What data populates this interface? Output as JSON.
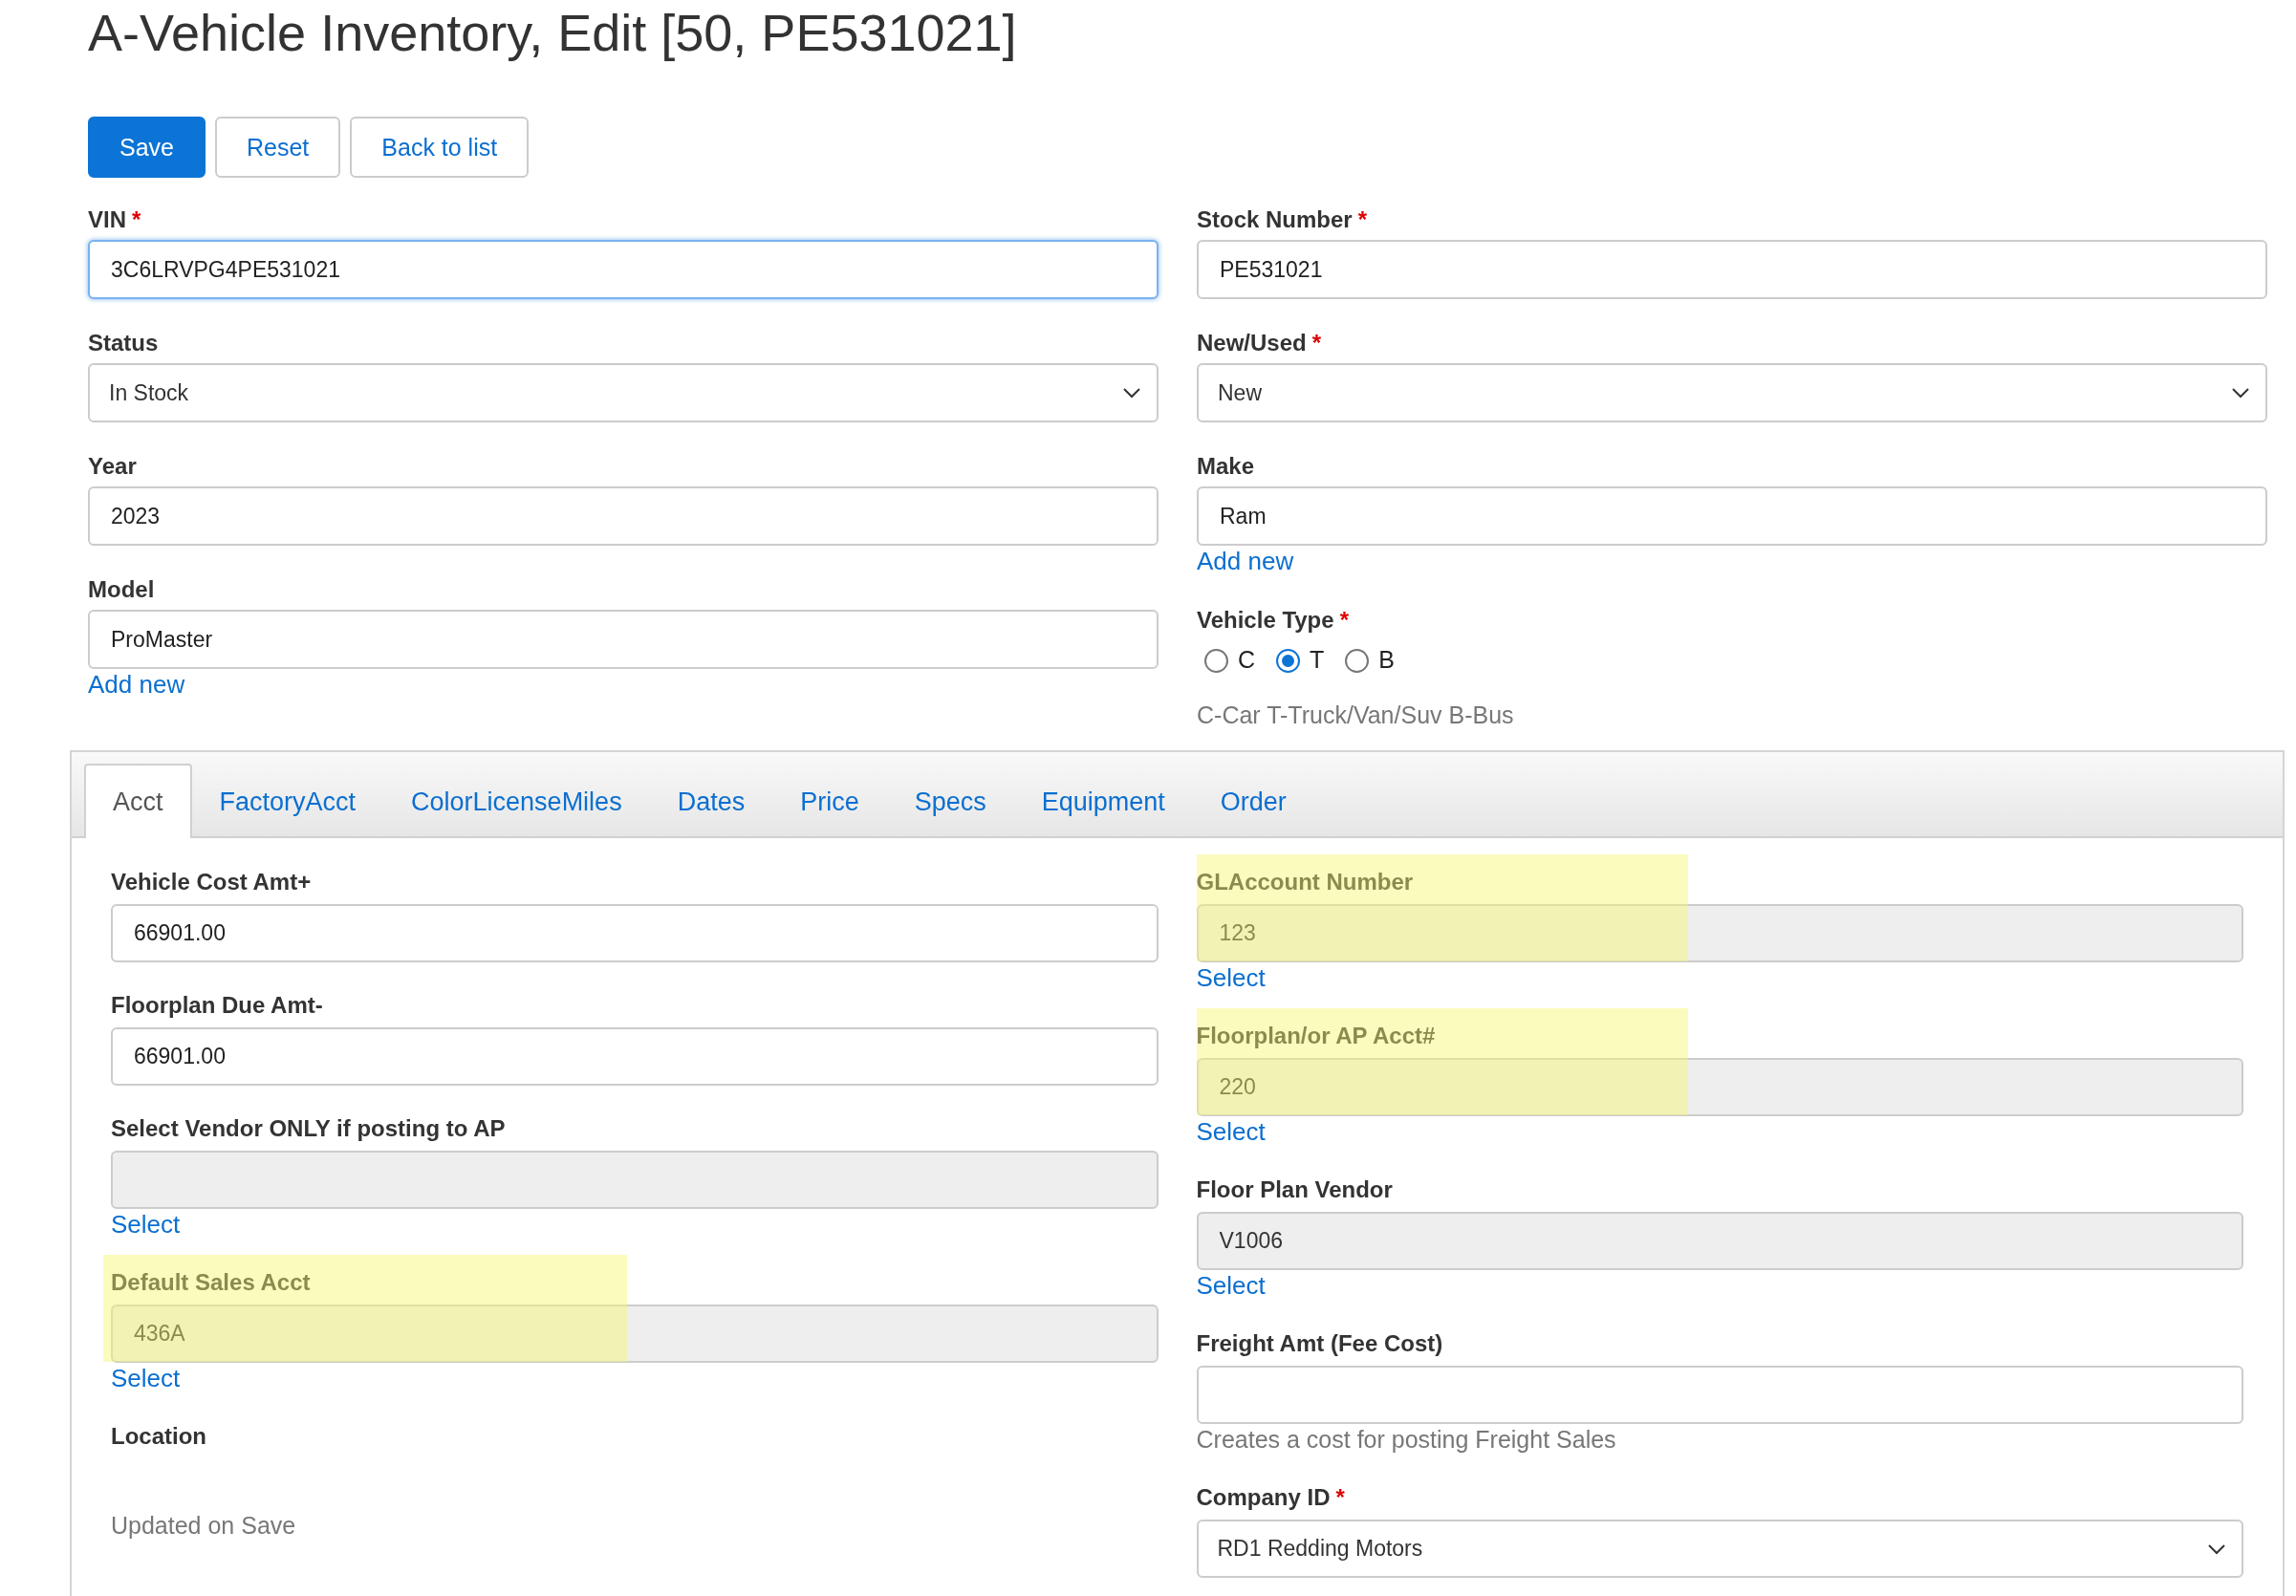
{
  "title": "A-Vehicle Inventory, Edit [50, PE531021]",
  "buttons": [
    {
      "label": "Save",
      "kind": "primary"
    },
    {
      "label": "Reset",
      "kind": "outline"
    },
    {
      "label": "Back to list",
      "kind": "outline"
    }
  ],
  "form": {
    "left": [
      {
        "label": "VIN",
        "required_mark": "*",
        "kind": "input",
        "value": "3C6LRVPG4PE531021",
        "focused": true,
        "readonly": false,
        "highlighted": false
      },
      {
        "label": "Status",
        "kind": "select",
        "value": "In Stock",
        "focused": false,
        "readonly": false,
        "highlighted": false
      },
      {
        "label": "Year",
        "kind": "input",
        "value": "2023",
        "focused": false,
        "readonly": false,
        "highlighted": false
      },
      {
        "label": "Model",
        "kind": "input",
        "value": "ProMaster",
        "focused": false,
        "readonly": false,
        "highlighted": false,
        "link": "Add new"
      }
    ],
    "right": [
      {
        "label": "Stock Number",
        "required_mark": "*",
        "kind": "input",
        "value": "PE531021",
        "focused": false,
        "readonly": false,
        "highlighted": false
      },
      {
        "label": "New/Used",
        "required_mark": "*",
        "kind": "select",
        "value": "New",
        "focused": false,
        "readonly": false,
        "highlighted": false
      },
      {
        "label": "Make",
        "kind": "input",
        "value": "Ram",
        "focused": false,
        "readonly": false,
        "highlighted": false,
        "link": "Add new"
      },
      {
        "label": "Vehicle Type",
        "required_mark": "*",
        "kind": "radios",
        "options": [
          {
            "label": "C",
            "selected": false
          },
          {
            "label": "T",
            "selected": true
          },
          {
            "label": "B",
            "selected": false
          }
        ],
        "help": "C-Car T-Truck/Van/Suv B-Bus"
      }
    ]
  },
  "tabs": [
    {
      "label": "Acct",
      "selected": true
    },
    {
      "label": "FactoryAcct",
      "selected": false
    },
    {
      "label": "ColorLicenseMiles",
      "selected": false
    },
    {
      "label": "Dates",
      "selected": false
    },
    {
      "label": "Price",
      "selected": false
    },
    {
      "label": "Specs",
      "selected": false
    },
    {
      "label": "Equipment",
      "selected": false
    },
    {
      "label": "Order",
      "selected": false
    }
  ],
  "tab_panel": {
    "left": [
      {
        "label": "Vehicle Cost Amt+",
        "kind": "input",
        "value": "66901.00",
        "focused": false,
        "readonly": false,
        "highlighted": false
      },
      {
        "label": "Floorplan Due Amt-",
        "kind": "input",
        "value": "66901.00",
        "focused": false,
        "readonly": false,
        "highlighted": false
      },
      {
        "label": "Select Vendor ONLY if posting to AP",
        "kind": "input",
        "focused": false,
        "readonly": true,
        "highlighted": false,
        "link": "Select"
      },
      {
        "label": "Default Sales Acct",
        "kind": "input",
        "value": "436A",
        "focused": false,
        "readonly": true,
        "highlighted": true,
        "link": "Select"
      },
      {
        "label": "Location",
        "kind": "static",
        "help": "Updated on Save"
      }
    ],
    "right": [
      {
        "label": "GLAccount Number",
        "kind": "input",
        "value": "123",
        "focused": false,
        "readonly": true,
        "highlighted": true,
        "link": "Select"
      },
      {
        "label": "Floorplan/or AP Acct#",
        "kind": "input",
        "value": "220",
        "focused": false,
        "readonly": true,
        "highlighted": true,
        "link": "Select"
      },
      {
        "label": "Floor Plan Vendor",
        "kind": "input",
        "value": "V1006",
        "focused": false,
        "readonly": true,
        "highlighted": false,
        "link": "Select"
      },
      {
        "label": "Freight Amt (Fee Cost)",
        "kind": "input",
        "focused": false,
        "readonly": false,
        "highlighted": false,
        "help": "Creates a cost for posting Freight Sales"
      },
      {
        "label": "Company ID",
        "required_mark": "*",
        "kind": "select",
        "value": "RD1 Redding Motors",
        "focused": false,
        "readonly": false,
        "highlighted": false
      }
    ]
  }
}
